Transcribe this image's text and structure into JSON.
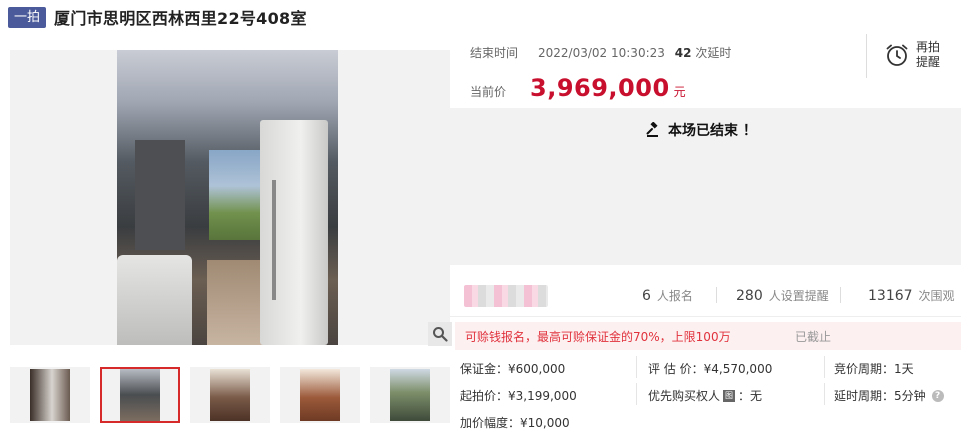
{
  "header": {
    "badge": "一拍",
    "title": "厦门市思明区西林西里22号408室"
  },
  "auction": {
    "end_label": "结束时间",
    "end_time": "2022/03/02 10:30:23",
    "delay_count": "42",
    "delay_label": "次延时",
    "price_label": "当前价",
    "price": "3,969,000",
    "price_unit": "元",
    "remind_label": "再拍提醒",
    "ended_text": "本场已结束 ！"
  },
  "stats": {
    "signup_count": "6",
    "signup_label": "人报名",
    "remind_count": "280",
    "remind_label": "人设置提醒",
    "view_count": "13167",
    "view_label": "次围观"
  },
  "notice": {
    "text": "可赊钱报名，最高可赊保证金的70%，上限100万",
    "status": "已截止"
  },
  "details": {
    "deposit": "保证金：¥600,000",
    "appraisal": "评 估 价：¥4,570,000",
    "bid_period": "竞价周期：1天",
    "start_price": "起拍价：¥3,199,000",
    "priority_prefix": "优先购买权人",
    "priority_icon": "图",
    "priority_value": "：无",
    "delay_period": "延时周期：5分钟",
    "increment": "加价幅度：¥10,000"
  },
  "icons": {
    "zoom": "search-icon",
    "alarm": "alarm-clock-icon",
    "gavel": "gavel-icon",
    "help": "question-icon"
  },
  "colors": {
    "accent_red": "#c8102e",
    "badge_blue": "#4a5a9a",
    "notice_bg": "#fdf0f1",
    "notice_text": "#e0323c"
  }
}
